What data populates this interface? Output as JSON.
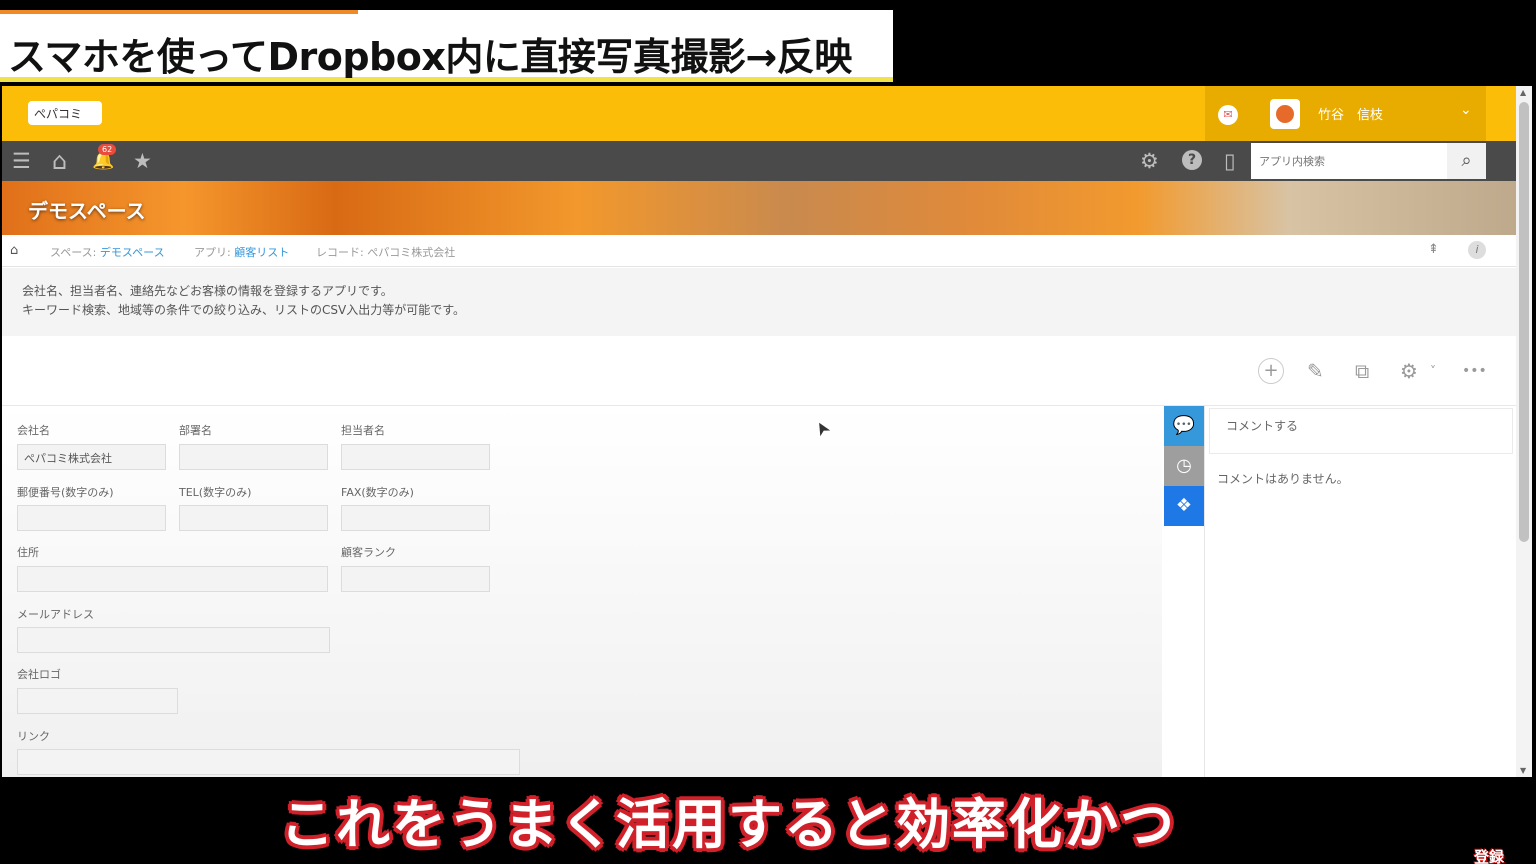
{
  "overlay": {
    "title": "スマホを使ってDropbox内に直接写真撮影→反映",
    "subtitle": "これをうまく活用すると効率化かつ",
    "subscribe": "登録"
  },
  "header": {
    "logo_text": "ぺパコミ",
    "user_name": "竹谷　信枝",
    "caret": "⌄",
    "mail_icon": "✉"
  },
  "toolbar": {
    "menu_icon": "☰",
    "home_icon": "⌂",
    "bell_icon": "🔔",
    "notification_count": "62",
    "star_icon": "★",
    "gear_icon": "⚙",
    "help_icon": "?",
    "mobile_icon": "▯",
    "search_placeholder": "アプリ内検索",
    "search_icon": "⌕"
  },
  "banner": {
    "title": "デモスペース"
  },
  "breadcrumb": {
    "home_icon": "⌂",
    "space_prefix": "スペース: ",
    "space_name": "デモスペース",
    "app_prefix": "アプリ: ",
    "app_name": "顧客リスト",
    "record": "レコード: ぺパコミ株式会社",
    "pin_icon": "⇞",
    "info_icon": "i"
  },
  "description": {
    "line1": "会社名、担当者名、連絡先などお客様の情報を登録するアプリです。",
    "line2": "キーワード検索、地域等の条件での絞り込み、リストのCSV入出力等が可能です。"
  },
  "actions": {
    "add_icon": "+",
    "edit_icon": "✎",
    "copy_icon": "⧉",
    "settings_icon": "⚙",
    "settings_caret": "˅",
    "more_icon": "•••"
  },
  "form": {
    "company_label": "会社名",
    "company_value": "ぺパコミ株式会社",
    "dept_label": "部署名",
    "dept_value": "",
    "person_label": "担当者名",
    "person_value": "",
    "zip_label": "郵便番号(数字のみ)",
    "zip_value": "",
    "tel_label": "TEL(数字のみ)",
    "tel_value": "",
    "fax_label": "FAX(数字のみ)",
    "fax_value": "",
    "address_label": "住所",
    "address_value": "",
    "rank_label": "顧客ランク",
    "rank_value": "",
    "email_label": "メールアドレス",
    "email_value": "",
    "logo_label": "会社ロゴ",
    "logo_value": "",
    "link_label": "リンク",
    "link_value": ""
  },
  "side_tabs": {
    "chat_icon": "💬",
    "history_icon": "◷",
    "dropbox_icon": "❖"
  },
  "comments": {
    "input_placeholder": "コメントする",
    "empty_text": "コメントはありません。"
  },
  "cursor_icon": "➤"
}
